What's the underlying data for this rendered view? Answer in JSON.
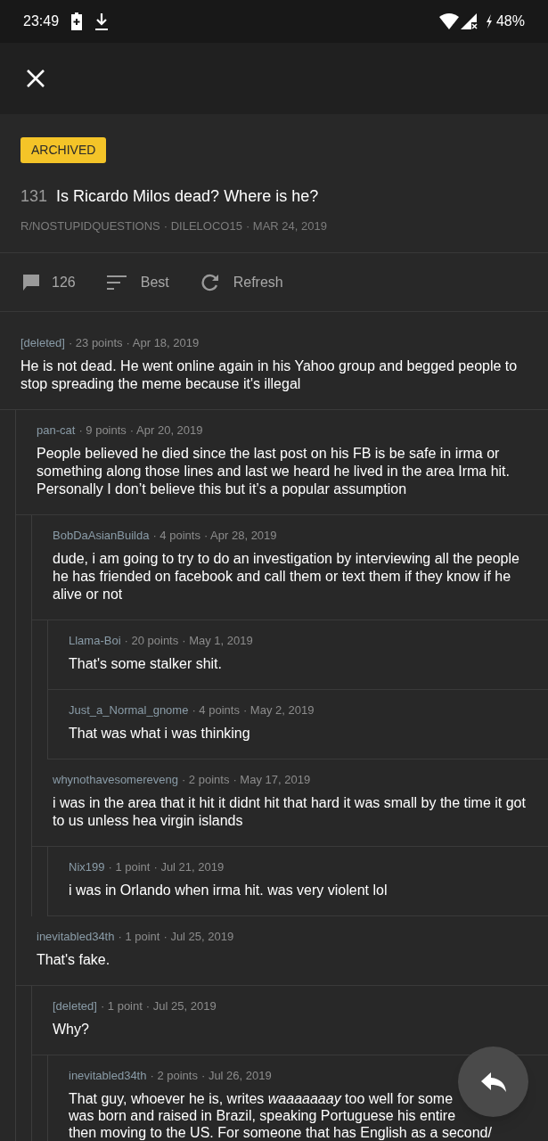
{
  "status_bar": {
    "time": "23:49",
    "battery": "48%"
  },
  "post": {
    "archived_badge": "ARCHIVED",
    "score": "131",
    "title": "Is Ricardo Milos dead? Where is he?",
    "subreddit": "R/NOSTUPIDQUESTIONS",
    "author": "· DILELOCO15",
    "date": "· MAR 24, 2019"
  },
  "actions": {
    "comment_count": "126",
    "sort": "Best",
    "refresh": "Refresh"
  },
  "comments": [
    {
      "author": "[deleted]",
      "points": "· 23 points",
      "date": "· Apr 18, 2019",
      "body": [
        "He is not dead. He went online again in his Yahoo group and begged people to stop spreading the meme because it's illegal"
      ],
      "children": [
        {
          "author": "pan-cat",
          "points": "· 9 points",
          "date": "· Apr 20, 2019",
          "body": [
            "People believed he died since the last post on his FB is be safe in irma or something along those lines and last we heard he lived in the area Irma hit. Personally I don’t believe this but it’s a popular assumption"
          ],
          "children": [
            {
              "author": "BobDaAsianBuilda",
              "points": "· 4 points",
              "date": "· Apr 28, 2019",
              "body": [
                "dude, i am going to try to do an investigation by interviewing all the people he has friended on facebook and call them or text them if they know if he alive or not"
              ],
              "children": [
                {
                  "author": "Llama-Boi",
                  "points": "· 20 points",
                  "date": "· May 1, 2019",
                  "body": [
                    "That's some stalker shit."
                  ]
                },
                {
                  "author": "Just_a_Normal_gnome",
                  "points": "· 4 points",
                  "date": "· May 2, 2019",
                  "body": [
                    "That was what i was thinking"
                  ]
                }
              ]
            },
            {
              "author": "whynothavesomereveng",
              "points": "· 2 points",
              "date": "· May 17, 2019",
              "body": [
                "i was in the area that it hit it didnt hit that hard it was small by the time it got to us unless hea virgin islands"
              ],
              "children": [
                {
                  "author": "Nix199",
                  "points": "· 1 point",
                  "date": "· Jul 21, 2019",
                  "body": [
                    "i was in Orlando when irma hit. was very violent lol"
                  ]
                }
              ]
            }
          ]
        },
        {
          "author": "inevitabled34th",
          "points": "· 1 point",
          "date": "· Jul 25, 2019",
          "body": [
            "That's fake."
          ],
          "children": [
            {
              "author": "[deleted]",
              "points": "· 1 point",
              "date": "· Jul 25, 2019",
              "body": [
                "Why?"
              ],
              "children": [
                {
                  "author": "inevitabled34th",
                  "points": "· 2 points",
                  "date": "· Jul 26, 2019",
                  "body": [
                    "That guy, whoever he is, writes *waaaaaaay* too well for some",
                    "was born and raised in Brazil, speaking Portuguese his entire",
                    "then moving to the US. For someone that has English as a second/"
                  ]
                }
              ]
            }
          ]
        }
      ]
    }
  ]
}
